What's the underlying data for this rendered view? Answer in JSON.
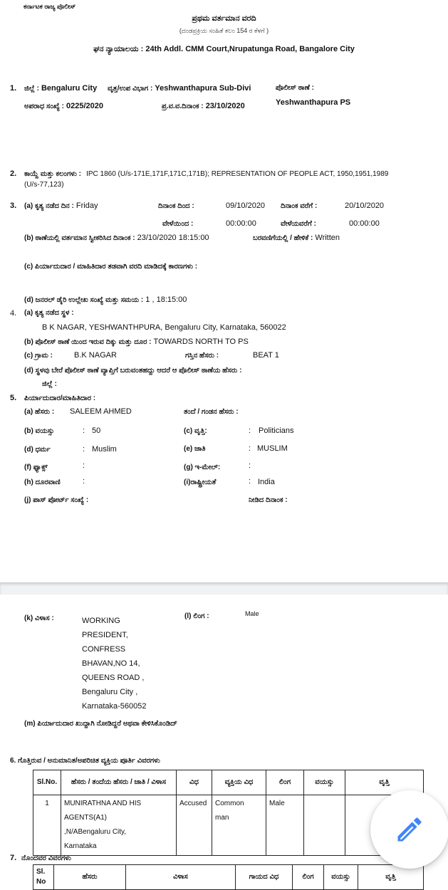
{
  "header": {
    "org": "ಕರ್ನಾಟಕ ರಾಜ್ಯ ಪೊಲೀಸ್",
    "title": "ಪ್ರಥಮ ವರ್ತಮಾನ ವರದಿ",
    "subtitle": "(ದಂಡಪ್ರಕ್ರಿಯ ಸಂಹಿತೆ ಕಲಂ 154 ರ ಕೆಳಗೆ )",
    "court_label": "ಘನ ನ್ಯಾಯಾಲಯ :",
    "court_value": "24th Addl. CMM Court,Nrupatunga Road, Bangalore City"
  },
  "section1": {
    "num": "1.",
    "district_label": "ಜಿಲ್ಲೆ :",
    "district_value": "Bengaluru City",
    "subdiv_label": "ವೃತ್ತ/ಉಪ ವಿಭಾಗ :",
    "subdiv_value": "Yeshwanthapura Sub-Divi",
    "ps_label": "ಪೊಲೀಸ್ ಠಾಣೆ :",
    "ps_value": "Yeshwanthapura PS",
    "crime_no_label": "ಅಪರಾಧ ಸಂಖ್ಯೆ :",
    "crime_no_value": "0225/2020",
    "fir_date_label": "ಪ್ರ.ವ.ವ.ದಿನಾಂಕ :",
    "fir_date_value": "23/10/2020"
  },
  "section2": {
    "num": "2.",
    "label": "ಕಾಯ್ದೆ ಮತ್ತು ಕಲಂಗಳು :",
    "value_line1": "IPC 1860 (U/s-171E,171F,171C,171B); REPRESENTATION OF PEOPLE ACT, 1950,1951,1989",
    "value_line2": "(U/s-77,123)"
  },
  "section3": {
    "num": "3.",
    "a_label": "(a) ಕೃತ್ಯ ನಡೆದ ದಿನ :",
    "a_value": "Friday",
    "date_from_label": "ದಿನಾಂಕ ದಿಂದ :",
    "date_from_value": "09/10/2020",
    "date_to_label": "ದಿನಾಂಕ ವರೆಗೆ :",
    "date_to_value": "20/10/2020",
    "time_from_label": "ವೇಳೆಯಿಂದ :",
    "time_from_value": "00:00:00",
    "time_to_label": "ವೇಳೆಯವರೆಗೆ :",
    "time_to_value": "00:00:00",
    "b_label": "(b) ಠಾಣೆಯಲ್ಲಿ ವರ್ತಮಾನ ಸ್ವೀಕರಿಸಿದ ದಿನಾಂಕ :",
    "b_value": "23/10/2020 18:15:00",
    "written_label": "ಬರವಣಿಗೆಯಲ್ಲಿ / ಹೇಳಿಕೆ :",
    "written_value": "Written",
    "c_label": "(c) ಪಿರ್ಯಾದುದಾರ / ಮಾಹಿತಿದಾರ ತಡವಾಗಿ ವರದಿ ಮಾಡಿದಕ್ಕೆ ಕಾರಣಗಳು :",
    "d_label": "(d) ಜನರಲ್ ಡೈರಿ ಉಲ್ಲೇಖ ಸಂಖ್ಯೆ ಮತ್ತು ಸಮಯ :",
    "d_value": "1 , 18:15:00"
  },
  "section4": {
    "num": "4.",
    "a_label": "(a) ಕೃತ್ಯ ನಡೆದ ಸ್ಥಳ :",
    "a_value": "B K NAGAR, YESHWANTHPURA, Bengaluru City, Karnataka, 560022",
    "b_label": "(b) ಪೊಲೀಸ್ ಠಾಣೆ ಯಿಂದ ಇರುವ ದಿಕ್ಕು ಮತ್ತು ದೂರ :",
    "b_value": "TOWARDS NORTH TO PS",
    "c_label": "(c) ಗ್ರಾಮ :",
    "c_value": "B.K NAGAR",
    "beat_label": "ಗಸ್ತಿನ ಹೆಸರು :",
    "beat_value": "BEAT 1",
    "d_label": "(d) ಸ್ಥಳವು ಬೇರೆ ಪೊಲೀಸ್ ಠಾಣೆ ವ್ಯಾಪ್ತಿಗೆ ಬರುವಂತಹದ್ದು ಆದರೆ ಆ ಪೊಲೀಸ್ ಠಾಣೆಯ ಹೆಸರು :",
    "district_label": "ಜಿಲ್ಲೆ :"
  },
  "section5": {
    "num": "5.",
    "label": "ಪಿರ್ಯಾದುದಾರ/ಮಾಹಿತಿದಾರ :",
    "a_label": "(a) ಹೆಸರು :",
    "a_value": "SALEEM AHMED",
    "father_label": "ತಂದೆ / ಗಂಡನ ಹೆಸರು :",
    "b_label": "(b) ವಯಸ್ಸು",
    "b_value": "50",
    "c_label": "(c) ವೃತ್ತಿ:",
    "c_value": "Politicians",
    "d_label": "(d) ಧರ್ಮ",
    "d_value": "Muslim",
    "e_label": "(e) ಜಾತಿ",
    "e_value": "MUSLIM",
    "f_label": "(f) ಫ್ಯಾಕ್ಸ್",
    "f_value": "",
    "g_label": "(g) ಇ-ಮೇಲ್:",
    "g_value": "",
    "h_label": "(h) ದೂರವಾಣಿ",
    "h_value": "",
    "i_label": "(i)ರಾಷ್ಟ್ರೀಯತೆ",
    "i_value": "India",
    "j_label": "(j) ಪಾಸ್ ಪೋರ್ಟ್ ಸಂಖ್ಯೆ :",
    "issue_date_label": "ನೀಡಿದ ದಿನಾಂಕ :",
    "colon": ":",
    "k_label": "(k) ವಿಳಾಸ :",
    "k_lines": [
      "WORKING",
      "PRESIDENT,",
      "CONFRESS",
      "BHAVAN,NO 14,",
      "QUEENS ROAD ,",
      "Bengaluru City ,",
      "Karnataka-560052"
    ],
    "l_label": "(l) ಲಿಂಗ :",
    "l_value": "Male",
    "m_label": "(m) ಪಿರ್ಯಾದುದಾರ ಖುದ್ದಾಗಿ ನೋಡಿದ್ದರೆ ಅಥವಾ ಕೇಳಿಸಿಕೊಂಡಿದ್"
  },
  "section6": {
    "title": "6. ಗೊತ್ತಿರುವ / ಅನುಮಾನಿತ/ಅಪರಿಚಿತ ವ್ಯಕ್ತಿಯ ಪೂರ್ತಿ ವಿವರಗಳು",
    "headers": [
      "Sl.No.",
      "ಹೆಸರು / ತಂದೆಯ ಹೆಸರು / ಜಾತಿ / ವಿಳಾಸ",
      "ವಿಧ",
      "ವ್ಯಕ್ತಿಯ ವಿಧ",
      "ಲಿಂಗ",
      "ವಯಸ್ಸು",
      "ವೃತ್ತಿ"
    ],
    "rows": [
      {
        "sl": "1",
        "name_lines": [
          "MUNIRATHNA AND HIS",
          "AGENTS(A1)",
          ",N/ABengaluru City,",
          "Karnataka"
        ],
        "type": "Accused",
        "person_type_lines": [
          "Common",
          "man"
        ],
        "gender": "Male",
        "age": "",
        "occupation": ""
      }
    ]
  },
  "section7": {
    "num": "7.",
    "title": "ನೊಂದವರ ವಿವರಗಳು",
    "headers": [
      "Sl. No",
      "ಹೆಸರು",
      "ವಿಳಾಸ",
      "ಗಾಯದ ವಿಧ",
      "ಲಿಂಗ",
      "ವಯಸ್ಸು",
      "ವೃತ್ತಿ"
    ]
  },
  "fab": {
    "icon": "pencil-edit-icon",
    "color": "#4285F4"
  }
}
